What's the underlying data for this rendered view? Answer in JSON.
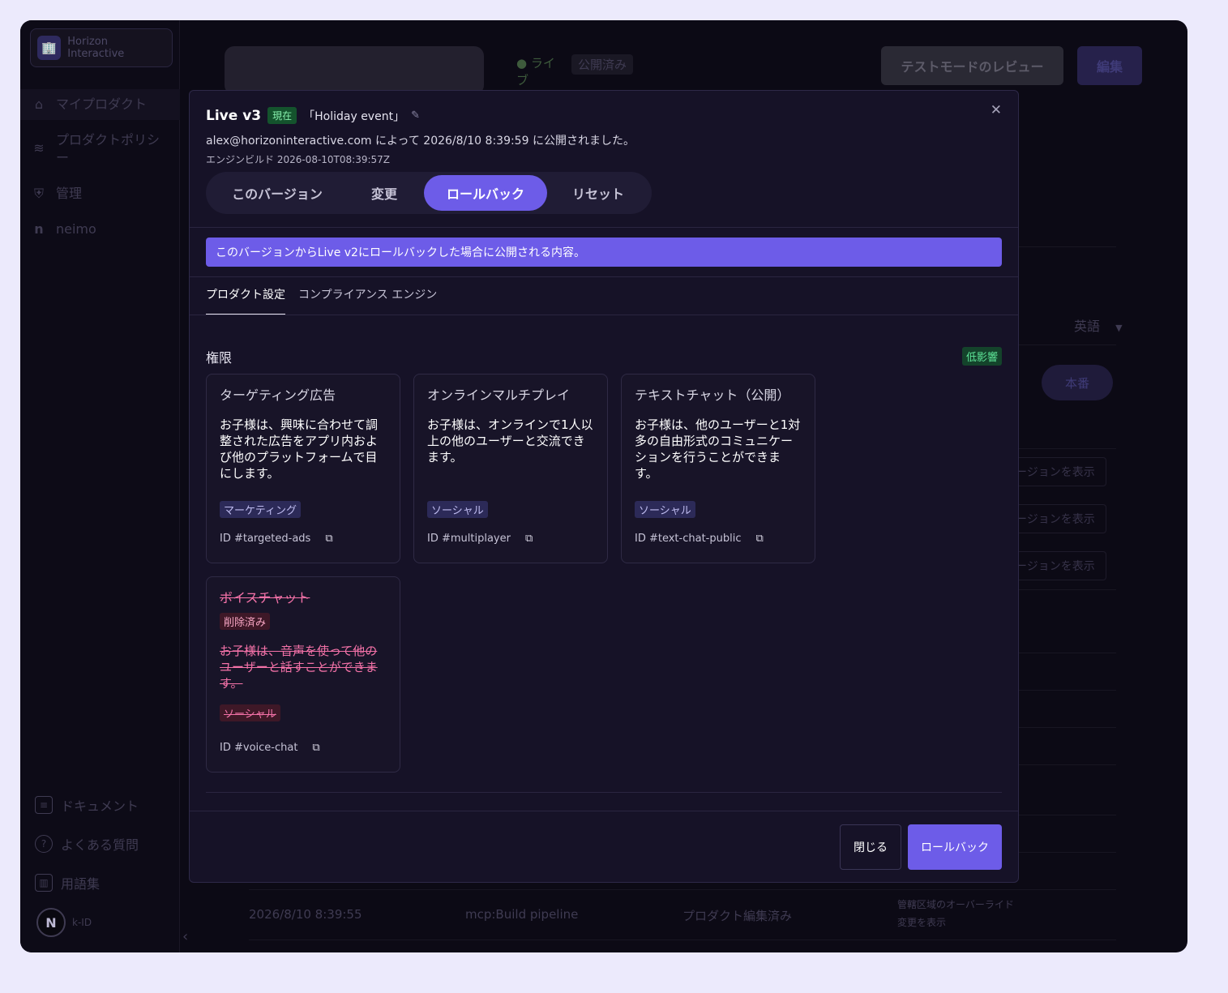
{
  "sidebar": {
    "org_logo": "🏢",
    "org_name": "Horizon Interactive",
    "items": [
      {
        "icon": "products-icon",
        "label": "マイプロダクト"
      },
      {
        "icon": "layers-icon",
        "label": "プロダクトポリシー"
      },
      {
        "icon": "shield-icon",
        "label": "管理"
      },
      {
        "icon": "n-icon",
        "label": "neimo"
      }
    ],
    "bottom_items": [
      {
        "icon": "document-icon",
        "label": "ドキュメント"
      },
      {
        "icon": "help-icon",
        "label": "よくある質問"
      },
      {
        "icon": "book-icon",
        "label": "用語集"
      }
    ],
    "user_initial": "N",
    "user_label": "k-ID"
  },
  "background": {
    "live_label": "● ライブ",
    "published_label": "公開済み",
    "review_button": "テストモードのレビュー",
    "edit_button": "編集",
    "language": "英語",
    "production": "本番",
    "view_version": "ージョンを表示",
    "row": {
      "date": "2026/8/10 8:39:55",
      "actor": "mcp:Build pipeline",
      "event": "プロダクト編集済み",
      "note1": "管轄区域のオーバーライド",
      "note2": "変更を表示"
    }
  },
  "modal": {
    "version": "Live v3",
    "current_badge": "現在",
    "event_name": "「Holiday event」",
    "published_text": "alex@horizoninteractive.com によって 2026/8/10 8:39:59 に公開されました。",
    "engine_build": "エンジンビルド 2026-08-10T08:39:57Z",
    "segments": [
      "このバージョン",
      "変更",
      "ロールバック",
      "リセット"
    ],
    "active_segment": "ロールバック",
    "banner": "このバージョンからLive v2にロールバックした場合に公開される内容。",
    "tabs": [
      "プロダクト設定",
      "コンプライアンス エンジン"
    ],
    "section_title": "権限",
    "impact_badge": "低影響",
    "cards": [
      {
        "title": "ターゲティング広告",
        "desc": "お子様は、興味に合わせて調整された広告をアプリ内および他のプラットフォームで目にします。",
        "tag": "マーケティング",
        "id": "ID #targeted-ads"
      },
      {
        "title": "オンラインマルチプレイ",
        "desc": "お子様は、オンラインで1人以上の他のユーザーと交流できます。",
        "tag": "ソーシャル",
        "id": "ID #multiplayer"
      },
      {
        "title": "テキストチャット（公開）",
        "desc": "お子様は、他のユーザーと1対多の自由形式のコミュニケーションを行うことができます。",
        "tag": "ソーシャル",
        "id": "ID #text-chat-public"
      }
    ],
    "removed_card": {
      "title": "ボイスチャット",
      "removed_badge": "削除済み",
      "desc": "お子様は、音声を使って他のユーザーと話すことができます。",
      "tag": "ソーシャル",
      "id": "ID #voice-chat"
    },
    "close_button": "閉じる",
    "rollback_button": "ロールバック"
  }
}
